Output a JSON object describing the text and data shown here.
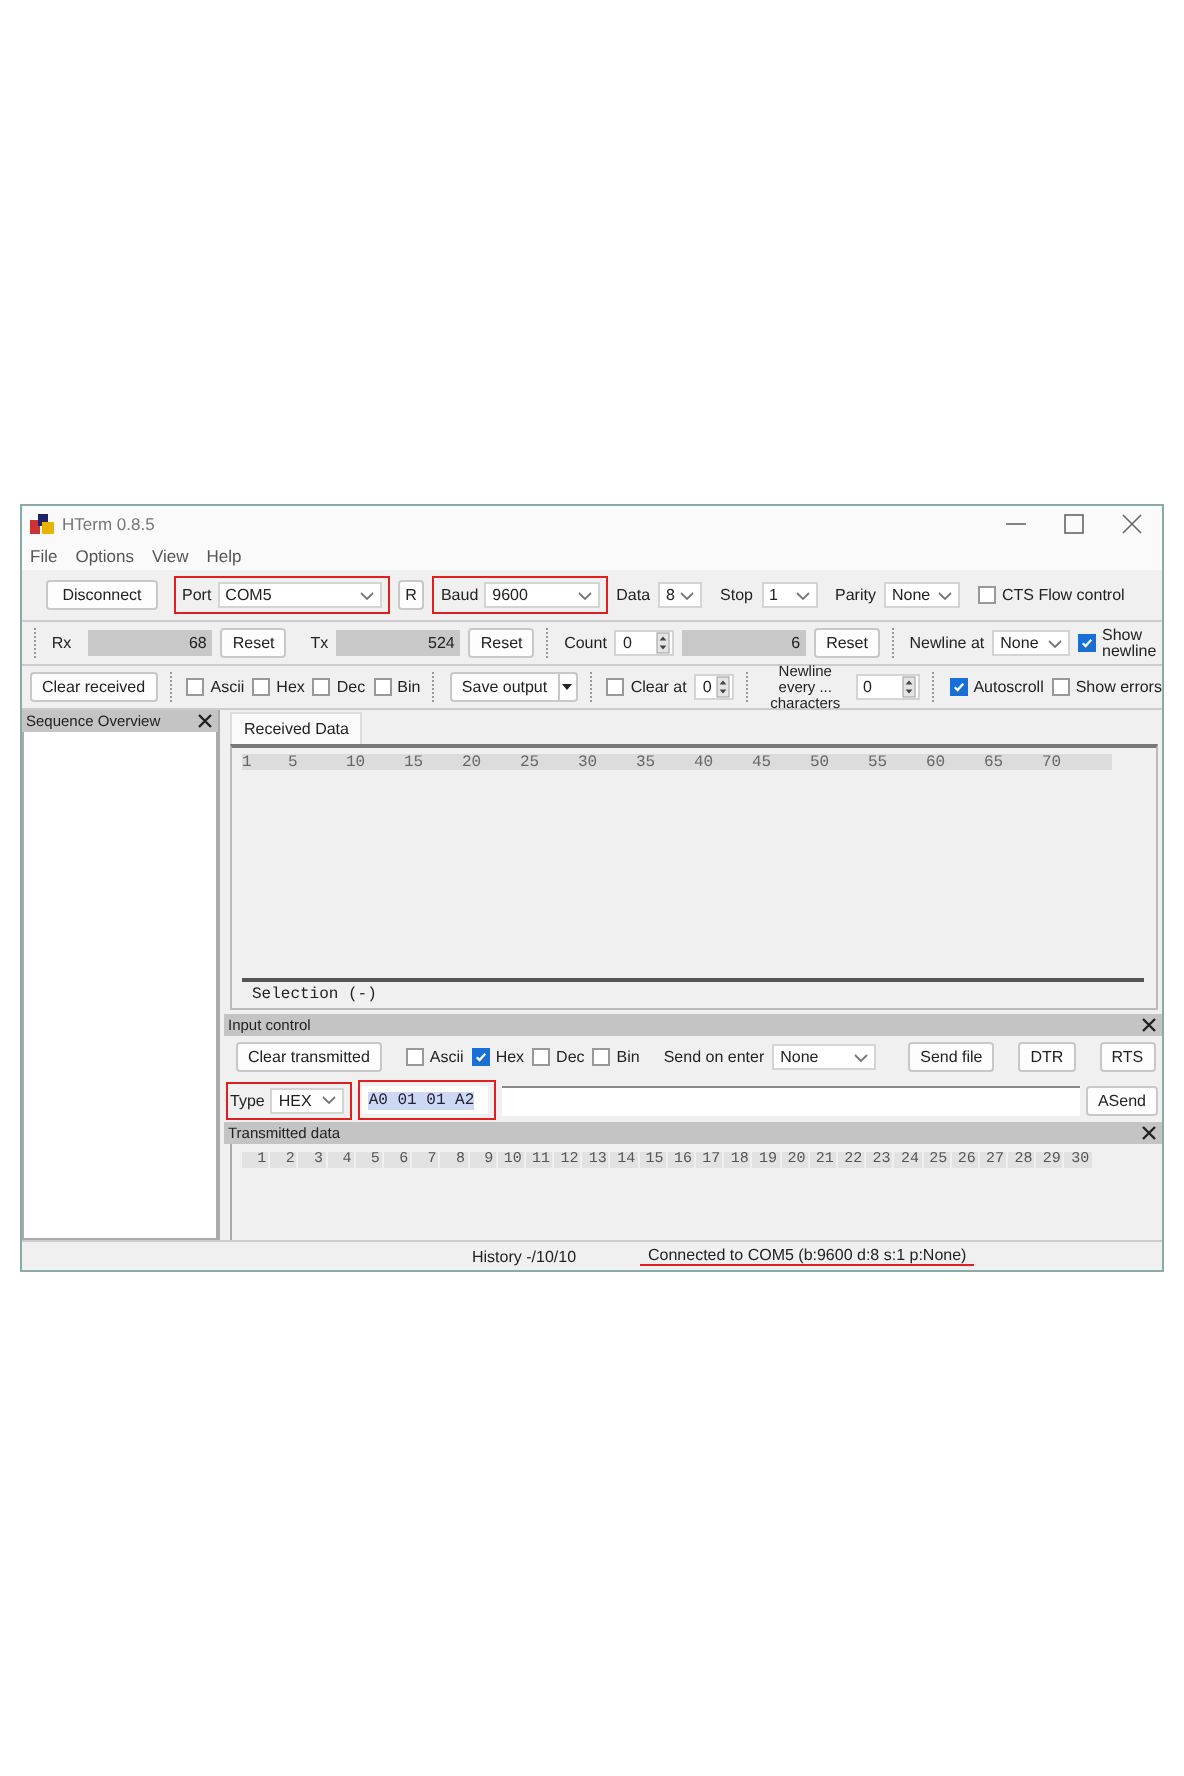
{
  "window": {
    "title": "HTerm 0.8.5"
  },
  "menu": [
    {
      "label": "File"
    },
    {
      "label": "Options"
    },
    {
      "label": "View"
    },
    {
      "label": "Help"
    }
  ],
  "connection": {
    "disconnect": "Disconnect",
    "port": {
      "label": "Port",
      "value": "COM5",
      "highlighted": true
    },
    "refresh": "R",
    "baud": {
      "label": "Baud",
      "value": "9600",
      "highlighted": true
    },
    "data_bits": {
      "label": "Data",
      "value": "8"
    },
    "stop_bits": {
      "label": "Stop",
      "value": "1"
    },
    "parity": {
      "label": "Parity",
      "value": "None"
    },
    "cts_flow": {
      "label": "CTS Flow control",
      "checked": false
    }
  },
  "counters": {
    "rx": {
      "label": "Rx",
      "value": "68",
      "reset": "Reset"
    },
    "tx": {
      "label": "Tx",
      "value": "524",
      "reset": "Reset"
    },
    "count": {
      "label": "Count",
      "value": "0",
      "total": "6",
      "reset": "Reset"
    },
    "newline_at": {
      "label": "Newline at",
      "value": "None"
    },
    "show_newline": {
      "label": "Show newline",
      "checked": true
    }
  },
  "display": {
    "clear_received": "Clear received",
    "formats": [
      {
        "label": "Ascii",
        "checked": false
      },
      {
        "label": "Hex",
        "checked": false
      },
      {
        "label": "Dec",
        "checked": false
      },
      {
        "label": "Bin",
        "checked": false
      }
    ],
    "save_output": "Save output",
    "clear_at": {
      "label": "Clear at",
      "checked": false,
      "value": "0"
    },
    "newline_every": {
      "label": "Newline every ... characters",
      "value": "0"
    },
    "autoscroll": {
      "label": "Autoscroll",
      "checked": true
    },
    "show_errors": {
      "label": "Show errors",
      "checked": false
    }
  },
  "sequence_overview": {
    "title": "Sequence Overview"
  },
  "received": {
    "tab": {
      "label": "Received Data",
      "selected": true
    },
    "ruler": [
      "1",
      "5",
      "10",
      "15",
      "20",
      "25",
      "30",
      "35",
      "40",
      "45",
      "50",
      "55",
      "60",
      "65",
      "70"
    ],
    "selection": "Selection (-)"
  },
  "input_control": {
    "title": "Input control",
    "clear_transmitted": "Clear transmitted",
    "formats": [
      {
        "label": "Ascii",
        "checked": false
      },
      {
        "label": "Hex",
        "checked": true
      },
      {
        "label": "Dec",
        "checked": false
      },
      {
        "label": "Bin",
        "checked": false
      }
    ],
    "send_on_enter": {
      "label": "Send on enter",
      "value": "None"
    },
    "buttons": [
      "Send file",
      "DTR",
      "RTS"
    ],
    "type": {
      "label": "Type",
      "value": "HEX",
      "highlighted": true
    },
    "input": {
      "value": "A0 01 01 A2",
      "selected": true,
      "highlighted": true
    },
    "send": "ASend"
  },
  "transmitted": {
    "title": "Transmitted data",
    "ruler": [
      "1",
      "2",
      "3",
      "4",
      "5",
      "6",
      "7",
      "8",
      "9",
      "10",
      "11",
      "12",
      "13",
      "14",
      "15",
      "16",
      "17",
      "18",
      "19",
      "20",
      "21",
      "22",
      "23",
      "24",
      "25",
      "26",
      "27",
      "28",
      "29",
      "30"
    ]
  },
  "status_bar": {
    "history": "History -/10/10",
    "connection": "Connected to COM5 (b:9600 d:8 s:1 p:None)",
    "underlined": true
  }
}
